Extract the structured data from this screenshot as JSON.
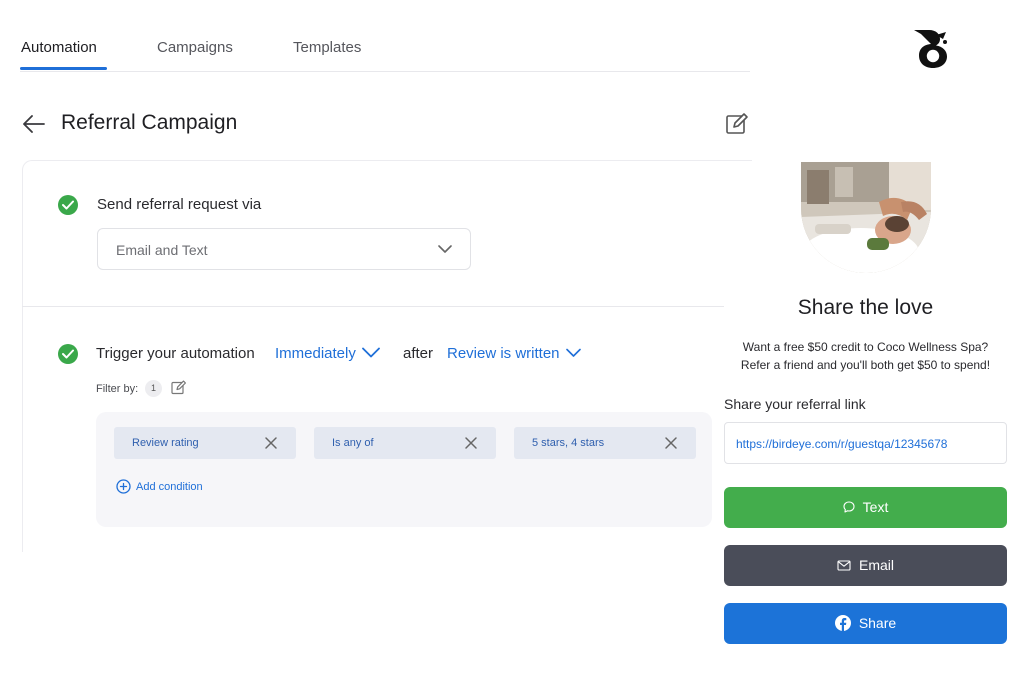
{
  "tabs": [
    {
      "label": "Automation",
      "active": true
    },
    {
      "label": "Campaigns",
      "active": false
    },
    {
      "label": "Templates",
      "active": false
    }
  ],
  "header": {
    "title": "Referral Campaign"
  },
  "send_step": {
    "label": "Send referral request via",
    "selected_value": "Email and Text"
  },
  "trigger_step": {
    "label": "Trigger your automation",
    "timing_value": "Immediately",
    "after_label": "after",
    "event_value": "Review is written",
    "filter_label": "Filter by:",
    "filter_count": "1",
    "conditions": [
      {
        "field": "Review rating"
      },
      {
        "operator": "Is any of"
      },
      {
        "value": "5 stars, 4 stars"
      }
    ],
    "add_condition_label": "Add condition"
  },
  "referral_panel": {
    "title": "Share the love",
    "promo_line_1": "Want a free $50 credit to Coco Wellness Spa?",
    "promo_line_2": "Refer a friend and you'll both get $50 to spend!",
    "link_label": "Share your referral link",
    "link_value": "https://birdeye.com/r/guestqa/12345678",
    "buttons": {
      "text": "Text",
      "email": "Email",
      "share": "Share"
    }
  },
  "colors": {
    "accent": "#1f6fd8",
    "success": "#3aa84a",
    "text_button": "#43ad4c",
    "email_button": "#4a4d59",
    "share_button": "#1c73d8"
  },
  "icons": [
    "back-arrow-icon",
    "edit-icon",
    "check-icon",
    "chevron-down-icon",
    "close-icon",
    "plus-circle-icon",
    "chat-bubble-icon",
    "mail-icon",
    "facebook-icon",
    "birdeye-logo"
  ]
}
